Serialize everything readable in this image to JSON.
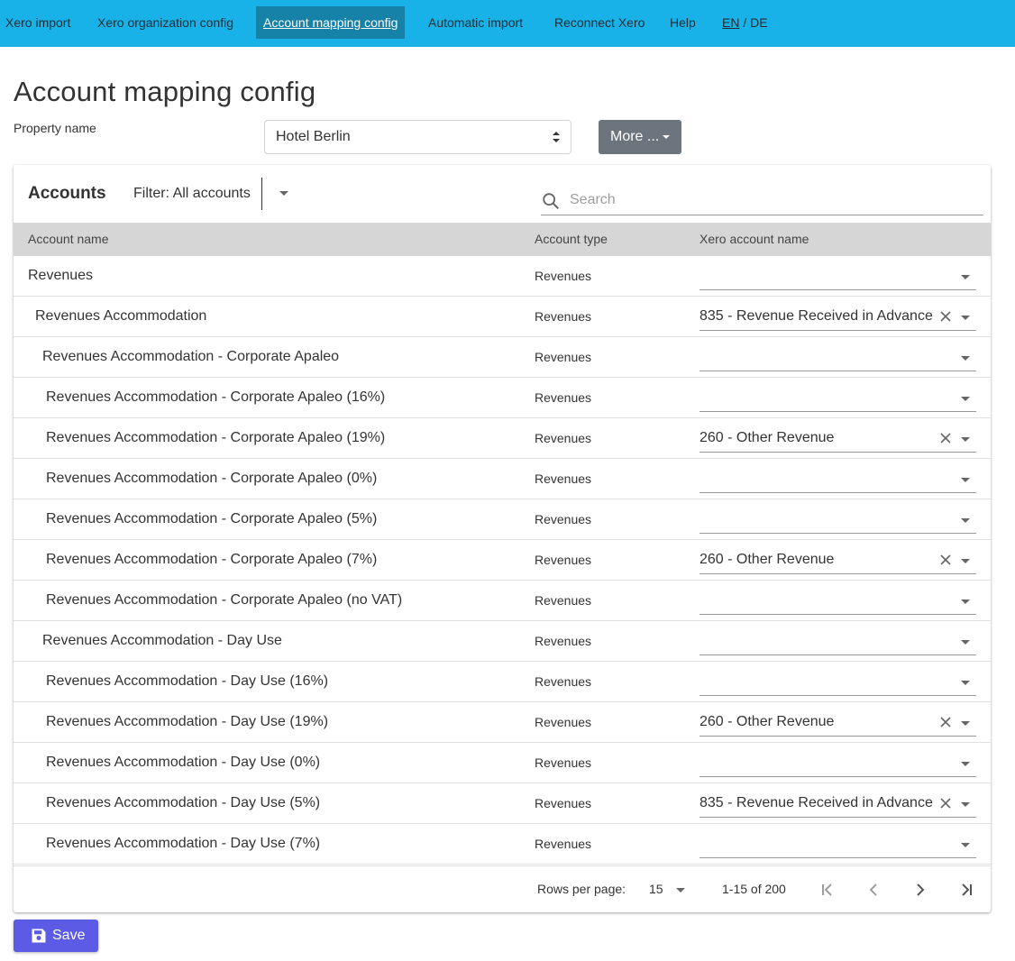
{
  "nav": {
    "items": [
      {
        "label": "Xero import",
        "active": false
      },
      {
        "label": "Xero organization config",
        "active": false
      },
      {
        "label": "Account mapping config",
        "active": true
      },
      {
        "label": "Automatic import",
        "active": false
      },
      {
        "label": "Reconnect Xero",
        "active": false
      },
      {
        "label": "Help",
        "active": false
      }
    ],
    "lang": {
      "en": "EN",
      "sep": " / ",
      "de": "DE"
    }
  },
  "page": {
    "title": "Account mapping config"
  },
  "property": {
    "label": "Property name",
    "selected": "Hotel Berlin"
  },
  "more_button": "More ...",
  "accounts": {
    "title": "Accounts",
    "filter": "Filter: All accounts",
    "search_placeholder": "Search",
    "columns": [
      "Account name",
      "Account type",
      "Xero account name"
    ],
    "rows": [
      {
        "name": "Revenues",
        "level": 0,
        "type": "Revenues",
        "xero": ""
      },
      {
        "name": "Revenues Accommodation",
        "level": 1,
        "type": "Revenues",
        "xero": "835 - Revenue Received in Advance"
      },
      {
        "name": "Revenues Accommodation - Corporate Apaleo",
        "level": 2,
        "type": "Revenues",
        "xero": ""
      },
      {
        "name": "Revenues Accommodation - Corporate Apaleo (16%)",
        "level": 3,
        "type": "Revenues",
        "xero": ""
      },
      {
        "name": "Revenues Accommodation - Corporate Apaleo (19%)",
        "level": 3,
        "type": "Revenues",
        "xero": "260 - Other Revenue"
      },
      {
        "name": "Revenues Accommodation - Corporate Apaleo (0%)",
        "level": 3,
        "type": "Revenues",
        "xero": ""
      },
      {
        "name": "Revenues Accommodation - Corporate Apaleo (5%)",
        "level": 3,
        "type": "Revenues",
        "xero": ""
      },
      {
        "name": "Revenues Accommodation - Corporate Apaleo (7%)",
        "level": 3,
        "type": "Revenues",
        "xero": "260 - Other Revenue"
      },
      {
        "name": "Revenues Accommodation - Corporate Apaleo (no VAT)",
        "level": 3,
        "type": "Revenues",
        "xero": ""
      },
      {
        "name": "Revenues Accommodation - Day Use",
        "level": 2,
        "type": "Revenues",
        "xero": ""
      },
      {
        "name": "Revenues Accommodation - Day Use (16%)",
        "level": 3,
        "type": "Revenues",
        "xero": ""
      },
      {
        "name": "Revenues Accommodation - Day Use (19%)",
        "level": 3,
        "type": "Revenues",
        "xero": "260 - Other Revenue"
      },
      {
        "name": "Revenues Accommodation - Day Use (0%)",
        "level": 3,
        "type": "Revenues",
        "xero": ""
      },
      {
        "name": "Revenues Accommodation - Day Use (5%)",
        "level": 3,
        "type": "Revenues",
        "xero": "835 - Revenue Received in Advance"
      },
      {
        "name": "Revenues Accommodation - Day Use (7%)",
        "level": 3,
        "type": "Revenues",
        "xero": ""
      }
    ]
  },
  "pagination": {
    "rows_per_page_label": "Rows per page:",
    "rows_per_page": "15",
    "range": "1-15 of 200"
  },
  "save_button": "Save"
}
